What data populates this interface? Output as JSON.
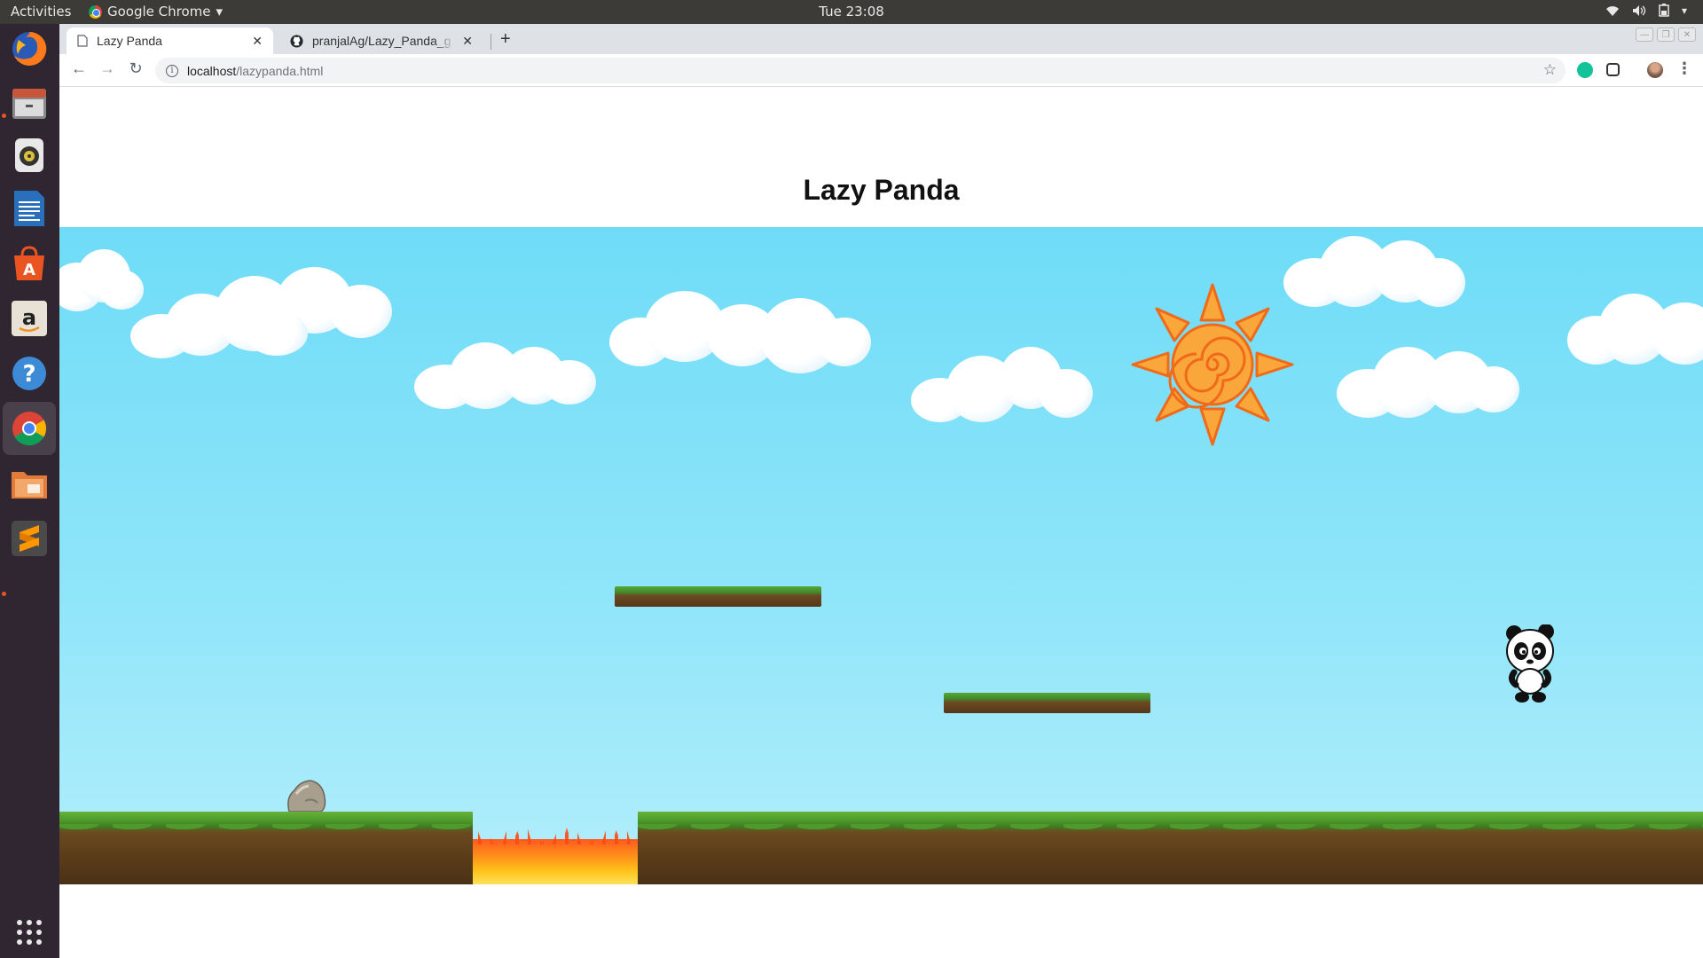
{
  "system": {
    "activities": "Activities",
    "app_name": "Google Chrome",
    "clock": "Tue 23:08"
  },
  "dock": {
    "items": [
      "firefox-icon",
      "files-icon",
      "rhythmbox-icon",
      "writer-icon",
      "software-center-icon",
      "amazon-icon",
      "help-icon",
      "chrome-icon",
      "file-manager-icon",
      "sublime-text-icon",
      "show-apps-icon"
    ]
  },
  "browser": {
    "tabs": [
      {
        "title": "Lazy Panda",
        "active": true
      },
      {
        "title": "pranjalAg/Lazy_Panda_g",
        "active": false
      }
    ],
    "url_host": "localhost",
    "url_path": "/lazypanda.html"
  },
  "page": {
    "title": "Lazy Panda"
  },
  "colors": {
    "sky_top": "#6fdcf7",
    "sky_bottom": "#b3eefc",
    "grass": "#4e9a2c",
    "dirt": "#5c3d1a",
    "sun": "#f7931e",
    "ubuntu_orange": "#e95420"
  }
}
